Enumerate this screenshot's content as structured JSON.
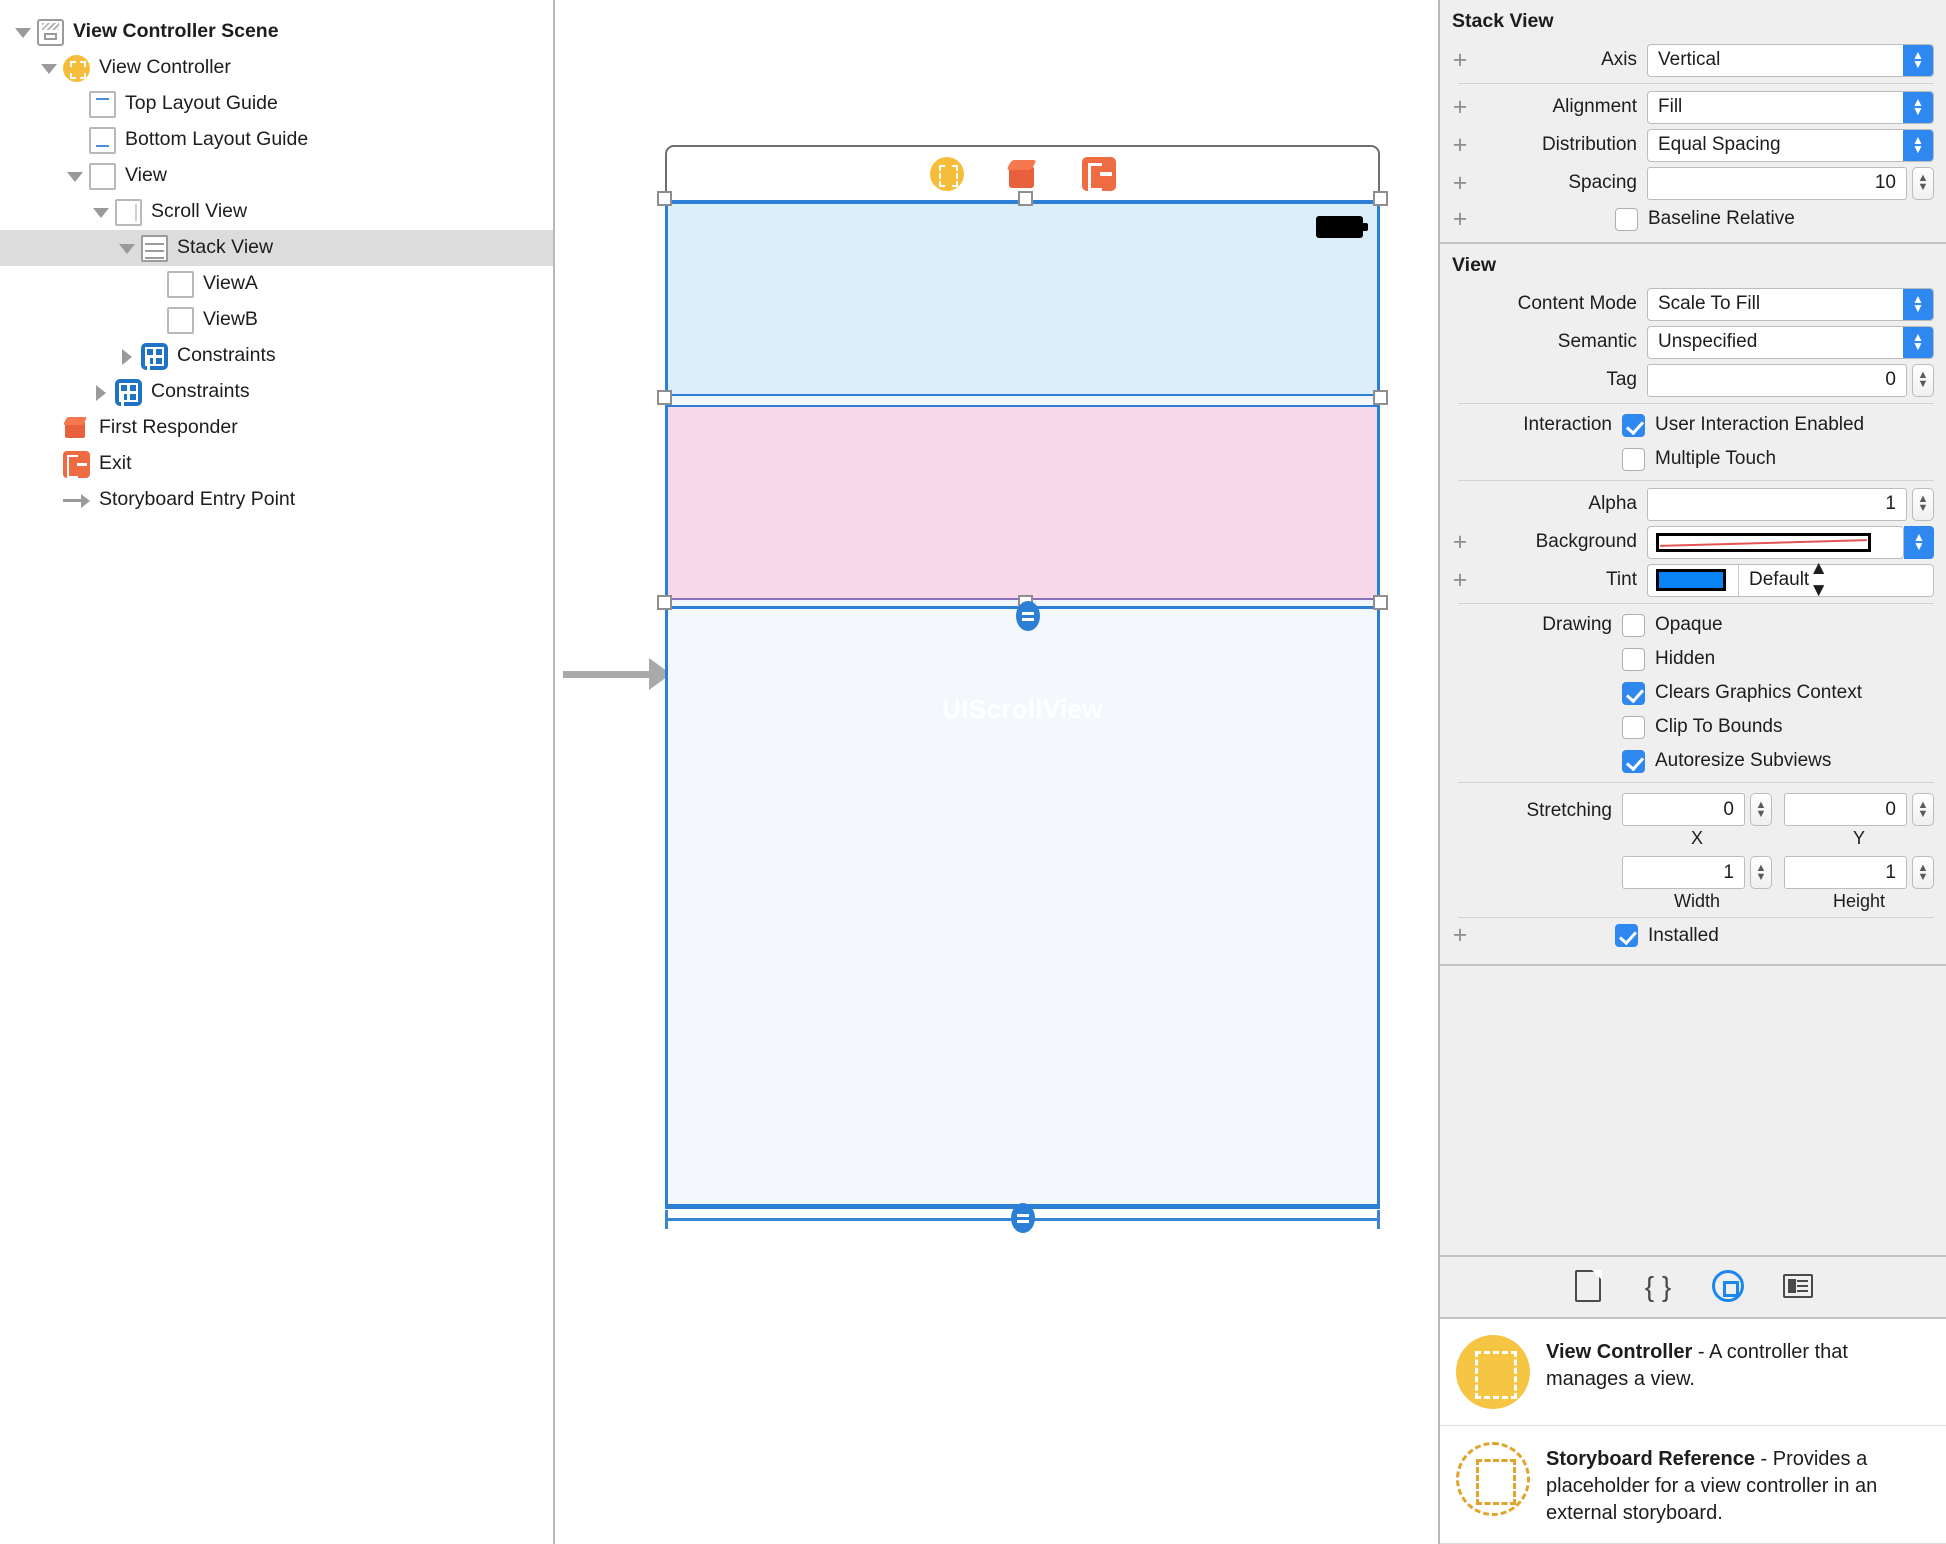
{
  "outline": {
    "rows": [
      {
        "label": "View Controller Scene",
        "icon": "scene-icon",
        "twist": "down",
        "indent": 0,
        "bold": true,
        "selected": false
      },
      {
        "label": "View Controller",
        "icon": "view-controller-icon",
        "twist": "down",
        "indent": 1,
        "bold": false,
        "selected": false
      },
      {
        "label": "Top Layout Guide",
        "icon": "top-layout-guide-icon",
        "twist": "none",
        "indent": 2,
        "bold": false,
        "selected": false
      },
      {
        "label": "Bottom Layout Guide",
        "icon": "bottom-layout-guide-icon",
        "twist": "none",
        "indent": 2,
        "bold": false,
        "selected": false
      },
      {
        "label": "View",
        "icon": "view-icon",
        "twist": "down",
        "indent": 2,
        "bold": false,
        "selected": false
      },
      {
        "label": "Scroll View",
        "icon": "scroll-view-icon",
        "twist": "down",
        "indent": 3,
        "bold": false,
        "selected": false
      },
      {
        "label": "Stack View",
        "icon": "stack-view-icon",
        "twist": "down",
        "indent": 4,
        "bold": false,
        "selected": true
      },
      {
        "label": "ViewA",
        "icon": "view-icon",
        "twist": "none",
        "indent": 5,
        "bold": false,
        "selected": false
      },
      {
        "label": "ViewB",
        "icon": "view-icon",
        "twist": "none",
        "indent": 5,
        "bold": false,
        "selected": false
      },
      {
        "label": "Constraints",
        "icon": "constraints-icon",
        "twist": "right",
        "indent": 4,
        "bold": false,
        "selected": false
      },
      {
        "label": "Constraints",
        "icon": "constraints-icon",
        "twist": "right",
        "indent": 3,
        "bold": false,
        "selected": false
      },
      {
        "label": "First Responder",
        "icon": "first-responder-icon",
        "twist": "none",
        "indent": 1,
        "bold": false,
        "selected": false
      },
      {
        "label": "Exit",
        "icon": "exit-icon",
        "twist": "none",
        "indent": 1,
        "bold": false,
        "selected": false
      },
      {
        "label": "Storyboard Entry Point",
        "icon": "entry-point-icon",
        "twist": "none",
        "indent": 1,
        "bold": false,
        "selected": false
      }
    ]
  },
  "canvas": {
    "dock_icons": [
      "view-controller-icon",
      "first-responder-icon",
      "exit-icon"
    ],
    "scrollview_watermark": "UIScrollView",
    "status_battery": "battery-icon"
  },
  "inspector": {
    "stack_view": {
      "title": "Stack View",
      "axis_label": "Axis",
      "axis_value": "Vertical",
      "alignment_label": "Alignment",
      "alignment_value": "Fill",
      "distribution_label": "Distribution",
      "distribution_value": "Equal Spacing",
      "spacing_label": "Spacing",
      "spacing_value": "10",
      "baseline_relative_label": "Baseline Relative",
      "baseline_relative_checked": false
    },
    "view": {
      "title": "View",
      "content_mode_label": "Content Mode",
      "content_mode_value": "Scale To Fill",
      "semantic_label": "Semantic",
      "semantic_value": "Unspecified",
      "tag_label": "Tag",
      "tag_value": "0",
      "interaction_label": "Interaction",
      "user_interaction_enabled_label": "User Interaction Enabled",
      "user_interaction_enabled_checked": true,
      "multiple_touch_label": "Multiple Touch",
      "multiple_touch_checked": false,
      "alpha_label": "Alpha",
      "alpha_value": "1",
      "background_label": "Background",
      "background_value": "",
      "tint_label": "Tint",
      "tint_value": "Default",
      "tint_color": "#0a84f5",
      "drawing_label": "Drawing",
      "opaque_label": "Opaque",
      "opaque_checked": false,
      "hidden_label": "Hidden",
      "hidden_checked": false,
      "clears_graphics_label": "Clears Graphics Context",
      "clears_graphics_checked": true,
      "clip_to_bounds_label": "Clip To Bounds",
      "clip_to_bounds_checked": false,
      "autoresize_subviews_label": "Autoresize Subviews",
      "autoresize_subviews_checked": true,
      "stretching_label": "Stretching",
      "stretch_x_value": "0",
      "stretch_x_sub": "X",
      "stretch_y_value": "0",
      "stretch_y_sub": "Y",
      "stretch_w_value": "1",
      "stretch_w_sub": "Width",
      "stretch_h_value": "1",
      "stretch_h_sub": "Height",
      "installed_label": "Installed",
      "installed_checked": true
    },
    "library": {
      "tabs": [
        {
          "icon": "file-template-icon",
          "selected": false
        },
        {
          "icon": "code-snippet-icon",
          "selected": false
        },
        {
          "icon": "object-library-icon",
          "selected": true
        },
        {
          "icon": "media-library-icon",
          "selected": false
        }
      ],
      "items": [
        {
          "icon": "view-controller-icon",
          "title": "View Controller",
          "desc": " - A controller that manages a view."
        },
        {
          "icon": "storyboard-reference-icon",
          "title": "Storyboard Reference",
          "desc": " - Provides a placeholder for a view controller in an external storyboard."
        }
      ]
    }
  },
  "colors": {
    "accent_blue": "#2b7fd4",
    "selection_blue": "#2f87f0",
    "view_a_fill": "#ddeefb",
    "view_b_fill": "#f7d8e8",
    "scroll_fill": "#f4f8fd",
    "orange": "#ef6b42",
    "yellow": "#f5bd3a"
  }
}
